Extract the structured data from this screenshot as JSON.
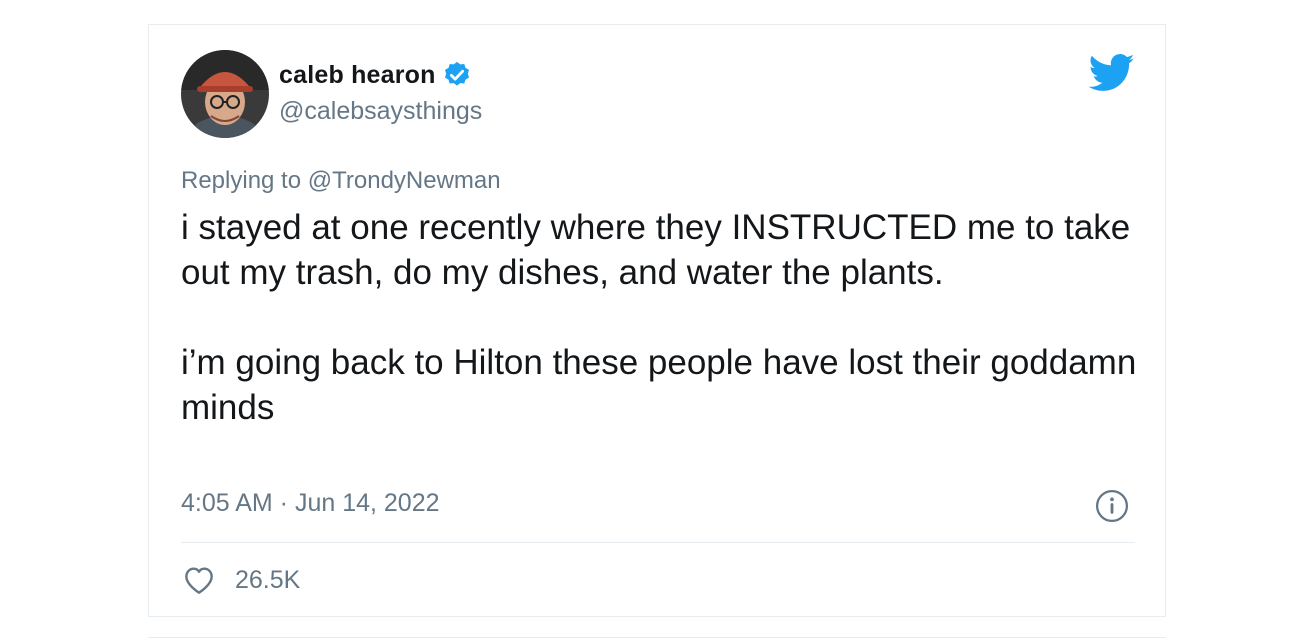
{
  "author": {
    "display_name": "caleb hearon",
    "handle": "@calebsaysthings",
    "verified": true,
    "avatar_icon": "user-photo"
  },
  "reply": {
    "prefix": "Replying to",
    "mention": "@TrondyNewman"
  },
  "tweet": {
    "paragraphs": [
      "i stayed at one recently where they INSTRUCTED me to take out my trash, do my dishes, and water the plants.",
      "i’m going back to Hilton these people have lost their goddamn minds"
    ],
    "timestamp": "4:05 AM · Jun 14, 2022",
    "like_count": "26.5K"
  },
  "icons": {
    "brand": "twitter-bird-icon",
    "verified": "verified-badge-icon",
    "info": "info-icon",
    "like": "heart-icon"
  },
  "colors": {
    "brand": "#1da1f2",
    "text": "#14171a",
    "secondary": "#657786"
  }
}
